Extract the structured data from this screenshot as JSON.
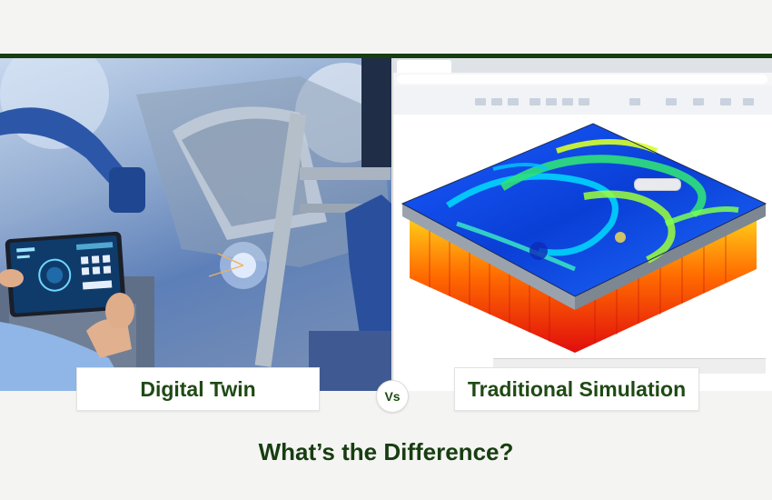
{
  "labels": {
    "left": "Digital Twin",
    "vs": "Vs",
    "right": "Traditional Simulation"
  },
  "headline": "What’s the Difference?",
  "colors": {
    "brand_green": "#173d10",
    "label_text": "#1f4a14"
  },
  "images": {
    "left": "robot-assembly-line-photo",
    "right": "cfd-simulation-screenshot"
  }
}
